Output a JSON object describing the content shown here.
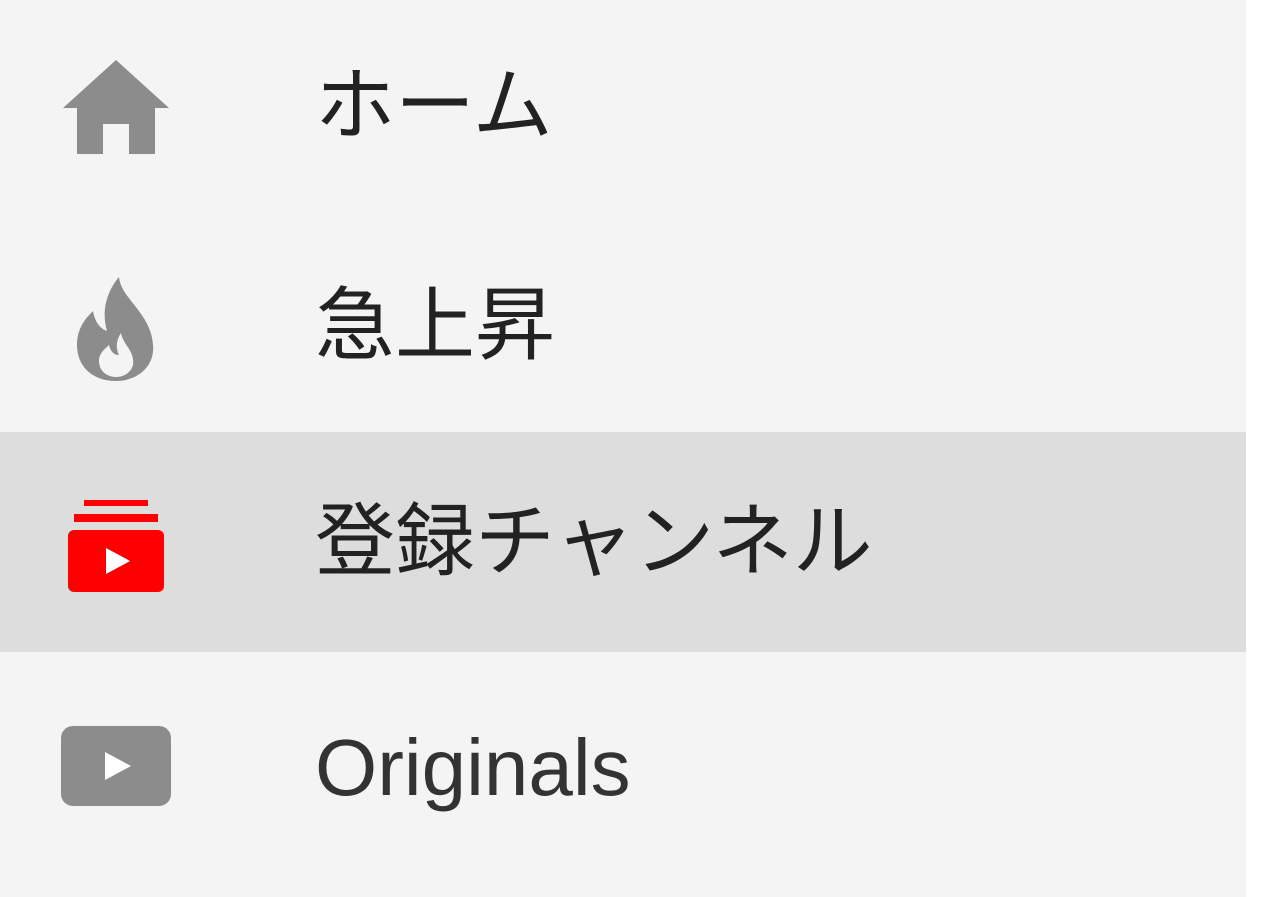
{
  "sidebar": {
    "items": [
      {
        "label": "ホーム",
        "icon": "home-icon",
        "active": false
      },
      {
        "label": "急上昇",
        "icon": "fire-icon",
        "active": false
      },
      {
        "label": "登録チャンネル",
        "icon": "subscriptions-icon",
        "active": true
      },
      {
        "label": "Originals",
        "icon": "originals-icon",
        "active": false
      }
    ]
  },
  "colors": {
    "background": "#f4f4f4",
    "active_background": "#dddddd",
    "icon_gray": "#8c8c8c",
    "active_icon": "#ff0000",
    "text": "#222222"
  }
}
